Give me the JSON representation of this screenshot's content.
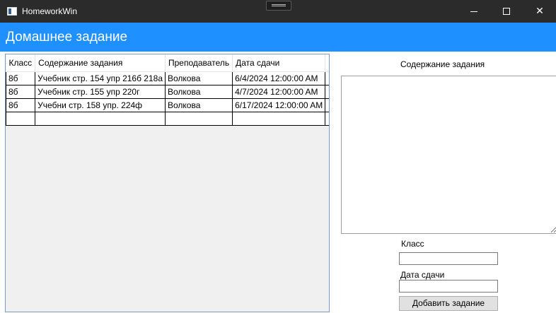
{
  "window": {
    "title": "HomeworkWin",
    "controls": {
      "minimize_icon": "minimize-icon",
      "maximize_icon": "maximize-icon",
      "close_icon": "close-icon",
      "close_glyph": "✕"
    }
  },
  "header": {
    "title": "Домашнее задание"
  },
  "grid": {
    "columns": [
      "Класс",
      "Содержание задания",
      "Преподаватель",
      "Дата сдачи"
    ],
    "rows": [
      [
        "8б",
        "Учебник стр. 154 упр 216б 218а",
        "Волкова",
        "6/4/2024 12:00:00 AM"
      ],
      [
        "8б",
        "Учебник стр. 155 упр 220г",
        "Волкова",
        "4/7/2024 12:00:00 AM"
      ],
      [
        "8б",
        "Учебни стр. 158 упр. 224ф",
        "Волкова",
        "6/17/2024 12:00:00 AM"
      ]
    ]
  },
  "form": {
    "content_label": "Содержание задания",
    "content_value": "",
    "class_label": "Класс",
    "class_value": "",
    "due_label": "Дата сдачи",
    "due_value": "",
    "add_button": "Добавить задание"
  }
}
